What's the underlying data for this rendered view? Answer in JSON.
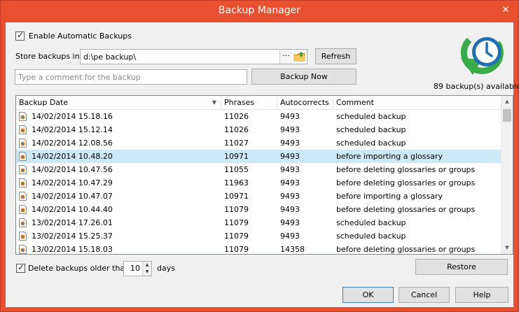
{
  "window": {
    "title": "Backup Manager",
    "close_glyph": "✕"
  },
  "settings": {
    "enable_label": "Enable Automatic Backups",
    "enable_checked": true,
    "store_label": "Store backups in:",
    "store_path": "d:\\pe backup\\",
    "browse_label": "···",
    "refresh_label": "Refresh",
    "comment_placeholder": "Type a comment for the backup",
    "backup_now_label": "Backup Now",
    "backup_count": "89 backup(s) available"
  },
  "grid": {
    "columns": [
      "Backup Date",
      "Phrases",
      "Autocorrects",
      "Comment"
    ],
    "rows": [
      {
        "date": "14/02/2014 15.18.16",
        "phrases": "11026",
        "autocorrects": "9493",
        "comment": "scheduled backup",
        "selected": false
      },
      {
        "date": "14/02/2014 15.12.14",
        "phrases": "11026",
        "autocorrects": "9493",
        "comment": "scheduled backup",
        "selected": false
      },
      {
        "date": "14/02/2014 12.08.56",
        "phrases": "11027",
        "autocorrects": "9493",
        "comment": "scheduled backup",
        "selected": false
      },
      {
        "date": "14/02/2014 10.48.20",
        "phrases": "10971",
        "autocorrects": "9493",
        "comment": "before importing a glossary",
        "selected": true
      },
      {
        "date": "14/02/2014 10.47.56",
        "phrases": "11055",
        "autocorrects": "9493",
        "comment": "before deleting glossaries or groups",
        "selected": false
      },
      {
        "date": "14/02/2014 10.47.29",
        "phrases": "11963",
        "autocorrects": "9493",
        "comment": "before deleting glossaries or groups",
        "selected": false
      },
      {
        "date": "14/02/2014 10.47.07",
        "phrases": "10971",
        "autocorrects": "9493",
        "comment": "before importing a glossary",
        "selected": false
      },
      {
        "date": "14/02/2014 10.44.40",
        "phrases": "11079",
        "autocorrects": "9493",
        "comment": "before deleting glossaries or groups",
        "selected": false
      },
      {
        "date": "13/02/2014 17.26.01",
        "phrases": "11079",
        "autocorrects": "9493",
        "comment": "scheduled backup",
        "selected": false
      },
      {
        "date": "13/02/2014 15.25.37",
        "phrases": "11079",
        "autocorrects": "9493",
        "comment": "scheduled backup",
        "selected": false
      },
      {
        "date": "13/02/2014 15.18.03",
        "phrases": "11079",
        "autocorrects": "14358",
        "comment": "before deleting glossaries or groups",
        "selected": false
      }
    ]
  },
  "retention": {
    "delete_label": "Delete backups older than:",
    "delete_checked": true,
    "days_value": "10",
    "days_label": "days",
    "restore_label": "Restore"
  },
  "footer": {
    "ok_label": "OK",
    "cancel_label": "Cancel",
    "help_label": "Help"
  },
  "colors": {
    "title_bar": "#e8502f",
    "selected_row": "#cde8f7",
    "logo_green": "#3aab48",
    "logo_blue": "#1f6fb2"
  }
}
